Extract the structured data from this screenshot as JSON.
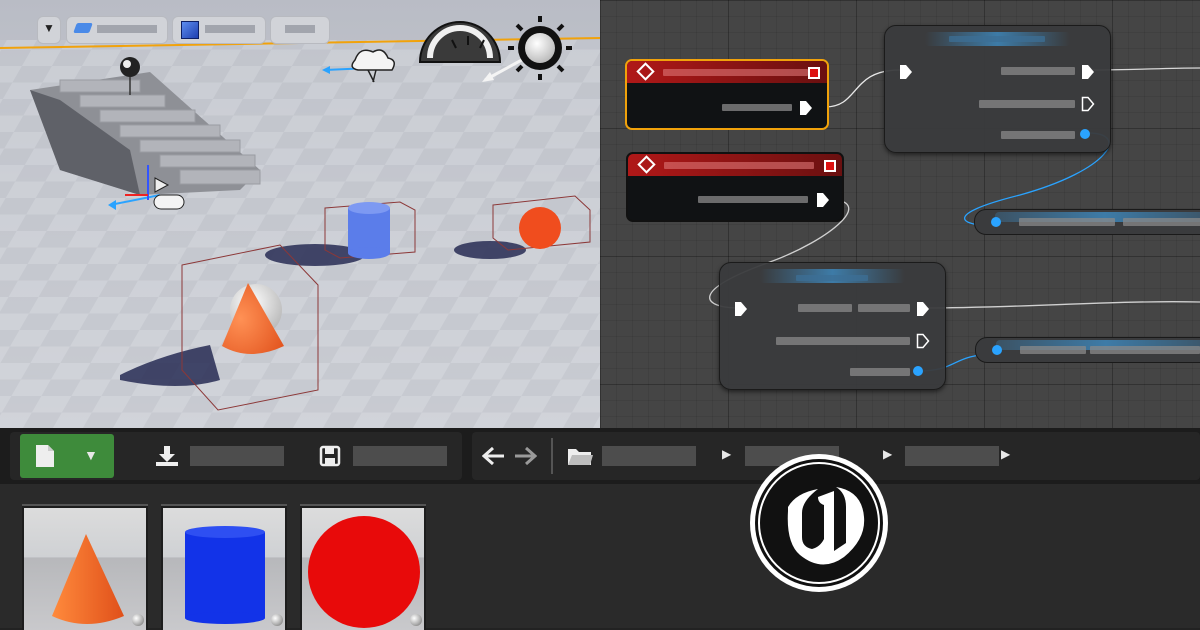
{
  "colors": {
    "accent_blue": "#2aa3ff",
    "event_red": "#b01818",
    "selection_orange": "#f1a20b",
    "add_button_green": "#3e8b3b",
    "cone_orange": "#f26a2e",
    "cylinder_blue": "#1233e8",
    "sphere_red": "#e80a0a"
  },
  "viewport": {
    "toolbar_icons": [
      "chevron-down-icon",
      "brush-icon",
      "cube-icon"
    ],
    "actors": [
      "staircase",
      "cone",
      "cylinder",
      "sphere",
      "sky-light",
      "directional-light",
      "player-start",
      "reflection-capture"
    ]
  },
  "graph": {
    "event_nodes": 2,
    "function_nodes": 2,
    "variable_nodes": 2
  },
  "toolbar": {
    "icons": [
      "file-icon",
      "chevron-down-icon",
      "download-icon",
      "save-icon",
      "arrow-left-icon",
      "arrow-right-icon",
      "folder-icon"
    ]
  },
  "content_browser": {
    "assets": [
      "cone",
      "cylinder",
      "sphere"
    ]
  },
  "logo": "unreal-engine-logo"
}
